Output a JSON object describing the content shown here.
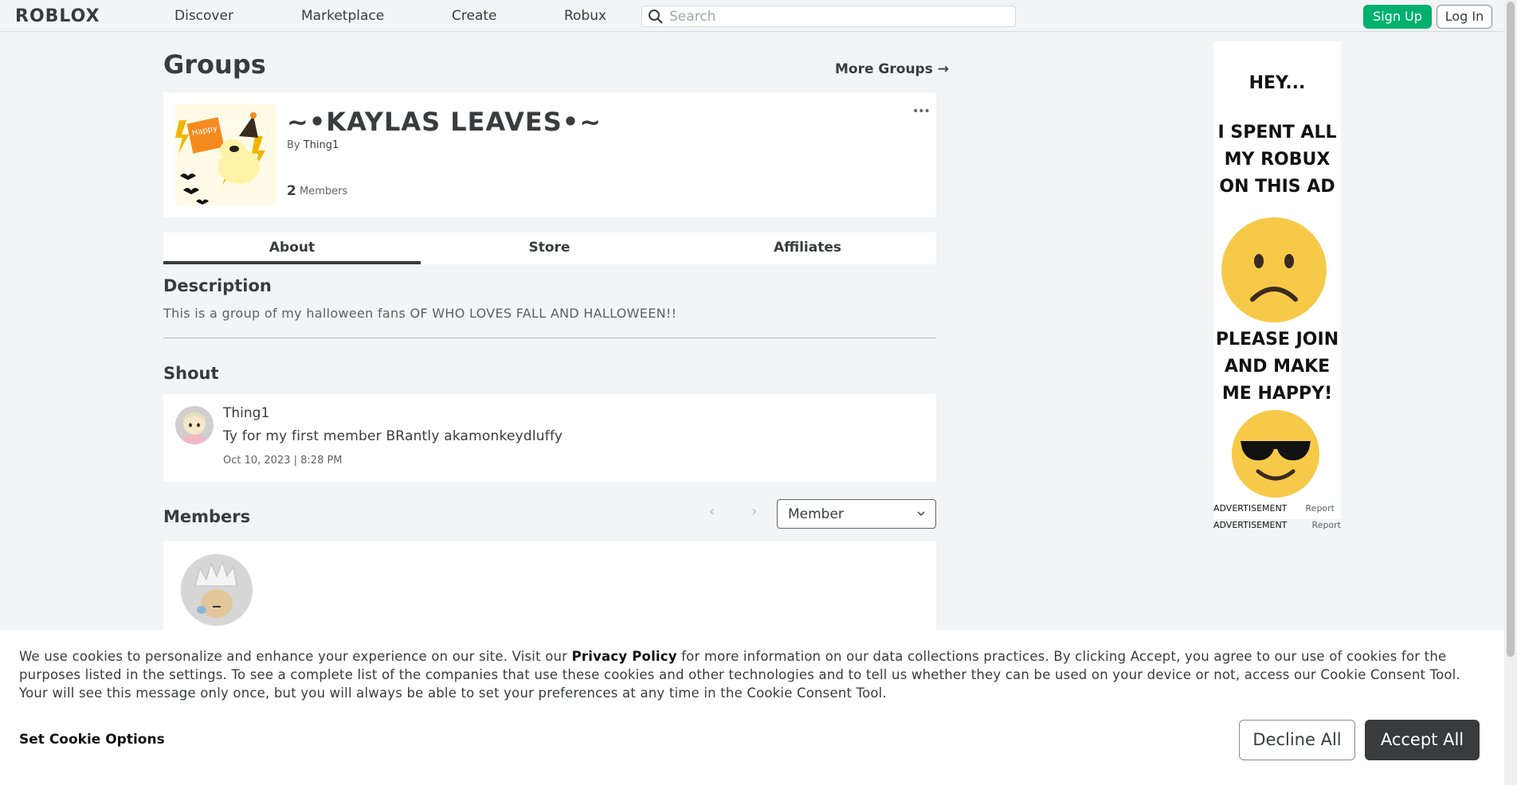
{
  "nav": {
    "logo": "ROBLOX",
    "links": [
      "Discover",
      "Marketplace",
      "Create",
      "Robux"
    ],
    "search_placeholder": "Search",
    "signup_label": "Sign Up",
    "login_label": "Log In"
  },
  "page": {
    "title": "Groups",
    "more_groups": "More Groups →"
  },
  "group": {
    "name": "~•KAYLAS LEAVES•~",
    "by_prefix": "By",
    "owner": "Thing1",
    "member_count": "2",
    "member_label": "Members",
    "emblem_text": "Happy Halloween",
    "more_icon": "•••"
  },
  "tabs": [
    {
      "label": "About",
      "active": true
    },
    {
      "label": "Store",
      "active": false
    },
    {
      "label": "Affiliates",
      "active": false
    }
  ],
  "description": {
    "heading": "Description",
    "text": "This is a group of my halloween fans OF WHO LOVES FALL AND HALLOWEEN!!"
  },
  "shout": {
    "heading": "Shout",
    "user": "Thing1",
    "body": "Ty for my first member BRantly akamonkeydluffy",
    "date": "Oct 10, 2023 | 8:28 PM"
  },
  "members": {
    "heading": "Members",
    "role_selected": "Member",
    "prev_icon": "‹",
    "next_icon": "›"
  },
  "ad": {
    "lines": [
      "HEY...",
      "I SPENT ALL",
      "MY ROBUX",
      "ON THIS AD",
      "PLEASE JOIN",
      "AND MAKE",
      "ME HAPPY!"
    ],
    "label_inner": "ADVERTISEMENT",
    "report_inner": "Report",
    "label_outer": "ADVERTISEMENT",
    "report_outer": "Report"
  },
  "cookie": {
    "text_before": "We use cookies to personalize and enhance your experience on our site. Visit our ",
    "privacy_link": "Privacy Policy",
    "text_after": " for more information on our data collections practices. By clicking Accept, you agree to our use of cookies for the purposes listed in the settings. To see a complete list of the companies that use these cookies and other technologies and to tell us whether they can be used on your device or not, access our Cookie Consent Tool. Your will see this message only once, but you will always be able to set your preferences at any time in the Cookie Consent Tool.",
    "set_options": "Set Cookie Options",
    "decline": "Decline All",
    "accept": "Accept All"
  },
  "colors": {
    "accent_green": "#00b06f",
    "text_dark": "#393b3d",
    "page_bg": "#f2f4f5"
  }
}
